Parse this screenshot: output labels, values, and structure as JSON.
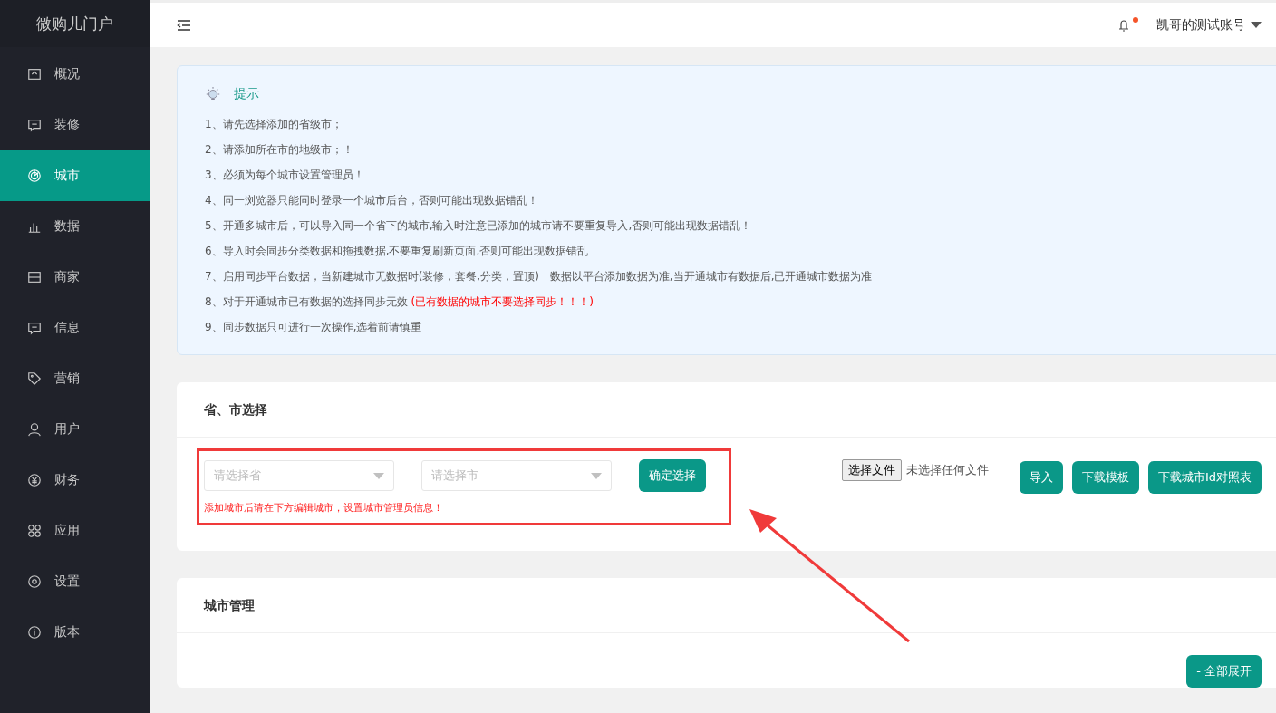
{
  "sidebar": {
    "logo": "微购儿门户",
    "items": [
      {
        "label": "概况",
        "selected": false
      },
      {
        "label": "装修",
        "selected": false
      },
      {
        "label": "城市",
        "selected": true
      },
      {
        "label": "数据",
        "selected": false
      },
      {
        "label": "商家",
        "selected": false
      },
      {
        "label": "信息",
        "selected": false
      },
      {
        "label": "营销",
        "selected": false
      },
      {
        "label": "用户",
        "selected": false
      },
      {
        "label": "财务",
        "selected": false
      },
      {
        "label": "应用",
        "selected": false
      },
      {
        "label": "设置",
        "selected": false
      },
      {
        "label": "版本",
        "selected": false
      }
    ]
  },
  "header": {
    "account": "凯哥的测试账号",
    "has_notification": true
  },
  "tips": {
    "title": "提示",
    "lines": [
      {
        "text": "1、请先选择添加的省级市；"
      },
      {
        "text": "2、请添加所在市的地级市；！"
      },
      {
        "text": "3、必须为每个城市设置管理员！"
      },
      {
        "text": "4、同一浏览器只能同时登录一个城市后台，否则可能出现数据错乱！"
      },
      {
        "text": "5、开通多城市后，可以导入同一个省下的城市,输入时注意已添加的城市请不要重复导入,否则可能出现数据错乱！"
      },
      {
        "text": "6、导入时会同步分类数据和拖拽数据,不要重复刷新页面,否则可能出现数据错乱"
      },
      {
        "text": "7、启用同步平台数据，当新建城市无数据时(装修，套餐,分类，置顶)　数据以平台添加数据为准,当开通城市有数据后,已开通城市数据为准"
      },
      {
        "text": "8、对于开通城市已有数据的选择同步无效 ",
        "warning": "(已有数据的城市不要选择同步！！！)"
      },
      {
        "text": "9、同步数据只可进行一次操作,选着前请慎重"
      }
    ]
  },
  "select_section": {
    "title": "省、市选择",
    "province": {
      "placeholder": "请选择省"
    },
    "city": {
      "placeholder": "请选择市"
    },
    "confirm_button": "确定选择",
    "notice": "添加城市后请在下方编辑城市，设置城市管理员信息！",
    "file_button": "选择文件",
    "file_status": "未选择任何文件",
    "buttons": [
      "导入",
      "下载模板",
      "下载城市Id对照表"
    ]
  },
  "manage_section": {
    "title": "城市管理",
    "expand_button": "- 全部展开"
  }
}
